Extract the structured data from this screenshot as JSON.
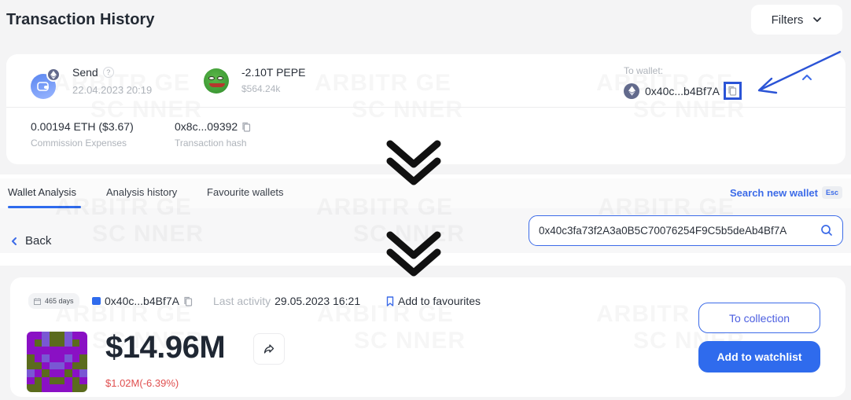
{
  "transaction_history": {
    "title": "Transaction History",
    "filters_label": "Filters",
    "transaction": {
      "type_label": "Send",
      "help_glyph": "?",
      "date": "22.04.2023 20:19",
      "token_amount": "-2.10T PEPE",
      "token_usd": "$564.24k",
      "to_wallet_label": "To wallet:",
      "to_wallet_address": "0x40c...b4Bf7A",
      "commission_value": "0.00194 ETH ($3.67)",
      "commission_label": "Commission Expenses",
      "hash_value": "0x8c...09392",
      "hash_label": "Transaction hash"
    },
    "icons": {
      "send": "wallet-icon",
      "network": "ethereum-icon",
      "token": "pepe-token-icon",
      "copy": "copy-icon",
      "collapse": "chevron-up-icon",
      "filters": "chevron-down-icon"
    }
  },
  "wallet_analysis": {
    "tabs": [
      {
        "label": "Wallet Analysis",
        "active": true
      },
      {
        "label": "Analysis history",
        "active": false
      },
      {
        "label": "Favourite wallets",
        "active": false
      }
    ],
    "search_new_label": "Search new wallet",
    "esc_label": "Esc",
    "back_label": "Back",
    "search_value": "0x40c3fa73f2A3a0B5C70076254F9C5b5deAb4Bf7A"
  },
  "wallet_summary": {
    "days_chip": "465 days",
    "address": "0x40c...b4Bf7A",
    "last_activity_label": "Last activity",
    "last_activity_value": "29.05.2023 16:21",
    "add_favourites_label": "Add to favourites",
    "balance": "$14.96M",
    "balance_change": "$1.02M(-6.39%)",
    "to_collection_label": "To collection",
    "add_watchlist_label": "Add to watchlist",
    "avatar_palette": {
      "P": "#8a10c4",
      "G": "#5b6b1d",
      "L": "#7957d4"
    },
    "avatar_grid": [
      "PPLGGLPP",
      "PGLGGLGP",
      "PPPPPPPP",
      "GPLPPLPG",
      "GGPLLPGG",
      "LPGPPGPL",
      "PGPGGPGP",
      "GGPPPPGG"
    ]
  },
  "watermark": {
    "line1": "ARBITR  GE",
    "line2": "SC  NNER"
  },
  "colors": {
    "accent": "#2f6bed",
    "negative": "#e04f4f",
    "annotation": "#2b54d6"
  }
}
